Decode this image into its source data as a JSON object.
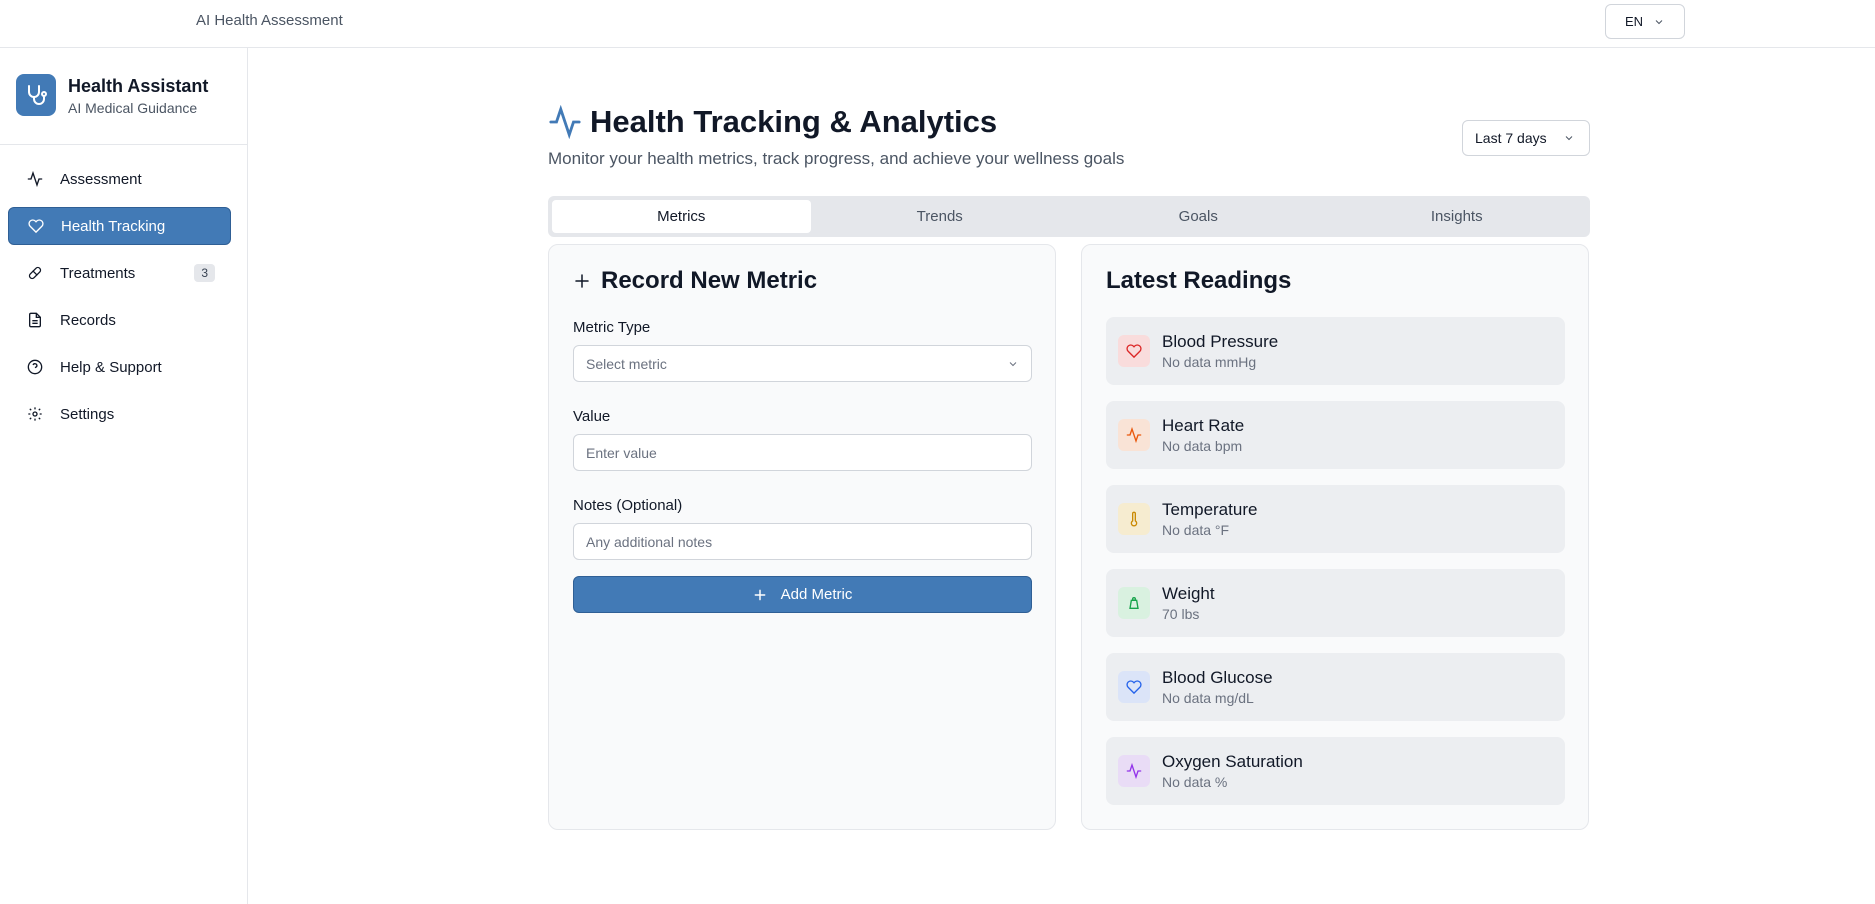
{
  "header": {
    "app_title": "AI Health Assessment",
    "language": "EN"
  },
  "brand": {
    "name": "Health Assistant",
    "subtitle": "AI Medical Guidance"
  },
  "sidebar": {
    "items": [
      {
        "label": "Assessment",
        "icon": "activity-icon"
      },
      {
        "label": "Health Tracking",
        "icon": "heart-icon",
        "active": true
      },
      {
        "label": "Treatments",
        "icon": "pill-icon",
        "badge": "3"
      },
      {
        "label": "Records",
        "icon": "document-icon"
      },
      {
        "label": "Help & Support",
        "icon": "help-circle-icon"
      },
      {
        "label": "Settings",
        "icon": "gear-icon"
      }
    ]
  },
  "page": {
    "title": "Health Tracking & Analytics",
    "subtitle": "Monitor your health metrics, track progress, and achieve your wellness goals",
    "range_select": "Last 7 days"
  },
  "tabs": [
    {
      "label": "Metrics",
      "active": true
    },
    {
      "label": "Trends"
    },
    {
      "label": "Goals"
    },
    {
      "label": "Insights"
    }
  ],
  "record_form": {
    "title": "Record New Metric",
    "metric_type_label": "Metric Type",
    "metric_type_placeholder": "Select metric",
    "value_label": "Value",
    "value_placeholder": "Enter value",
    "notes_label": "Notes (Optional)",
    "notes_placeholder": "Any additional notes",
    "submit_label": "Add Metric"
  },
  "latest_readings": {
    "title": "Latest Readings",
    "items": [
      {
        "name": "Blood Pressure",
        "value": "No data mmHg",
        "icon": "heart-icon",
        "color": "#dc2626",
        "bg": "#f9dcdc"
      },
      {
        "name": "Heart Rate",
        "value": "No data bpm",
        "icon": "activity-icon",
        "color": "#ea580c",
        "bg": "#f9e3d6"
      },
      {
        "name": "Temperature",
        "value": "No data °F",
        "icon": "thermometer-icon",
        "color": "#ca8a04",
        "bg": "#f6ecd0"
      },
      {
        "name": "Weight",
        "value": "70 lbs",
        "icon": "scale-icon",
        "color": "#16a34a",
        "bg": "#d9f1e0"
      },
      {
        "name": "Blood Glucose",
        "value": "No data mg/dL",
        "icon": "heart-icon",
        "color": "#2563eb",
        "bg": "#dbe4f8"
      },
      {
        "name": "Oxygen Saturation",
        "value": "No data %",
        "icon": "activity-icon",
        "color": "#9333ea",
        "bg": "#e9dcf6"
      }
    ]
  },
  "colors": {
    "accent": "#427ab6"
  }
}
